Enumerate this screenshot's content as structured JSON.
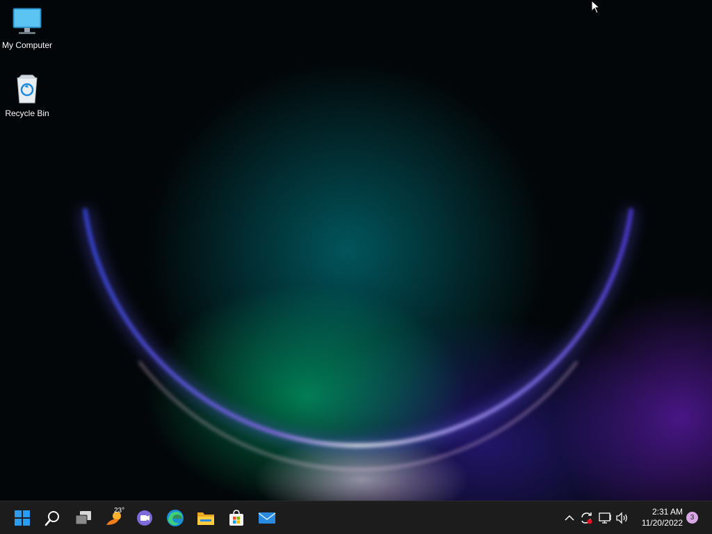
{
  "desktop": {
    "icons": [
      {
        "label": "My Computer",
        "icon": "monitor-icon"
      },
      {
        "label": "Recycle Bin",
        "icon": "recycle-bin-icon"
      }
    ]
  },
  "taskbar": {
    "apps": [
      {
        "name": "Start",
        "icon": "windows-start-icon"
      },
      {
        "name": "Search",
        "icon": "search-icon"
      },
      {
        "name": "Task View",
        "icon": "task-view-icon"
      },
      {
        "name": "Widgets",
        "icon": "weather-widget-icon"
      },
      {
        "name": "Chat",
        "icon": "teams-chat-icon"
      },
      {
        "name": "Microsoft Edge",
        "icon": "edge-icon"
      },
      {
        "name": "File Explorer",
        "icon": "file-explorer-icon"
      },
      {
        "name": "Microsoft Store",
        "icon": "store-icon"
      },
      {
        "name": "Mail",
        "icon": "mail-icon"
      }
    ],
    "weather_temp": "23°",
    "tray": {
      "icons": [
        "chevron-up-icon",
        "sync-icon",
        "network-icon",
        "volume-icon"
      ],
      "time": "2:31 AM",
      "date": "11/20/2022",
      "notification_count": "3"
    }
  },
  "colors": {
    "taskbar_bg": "#1c1c1c",
    "accent": "#0078d4",
    "notification_badge": "#d9a7e6"
  }
}
